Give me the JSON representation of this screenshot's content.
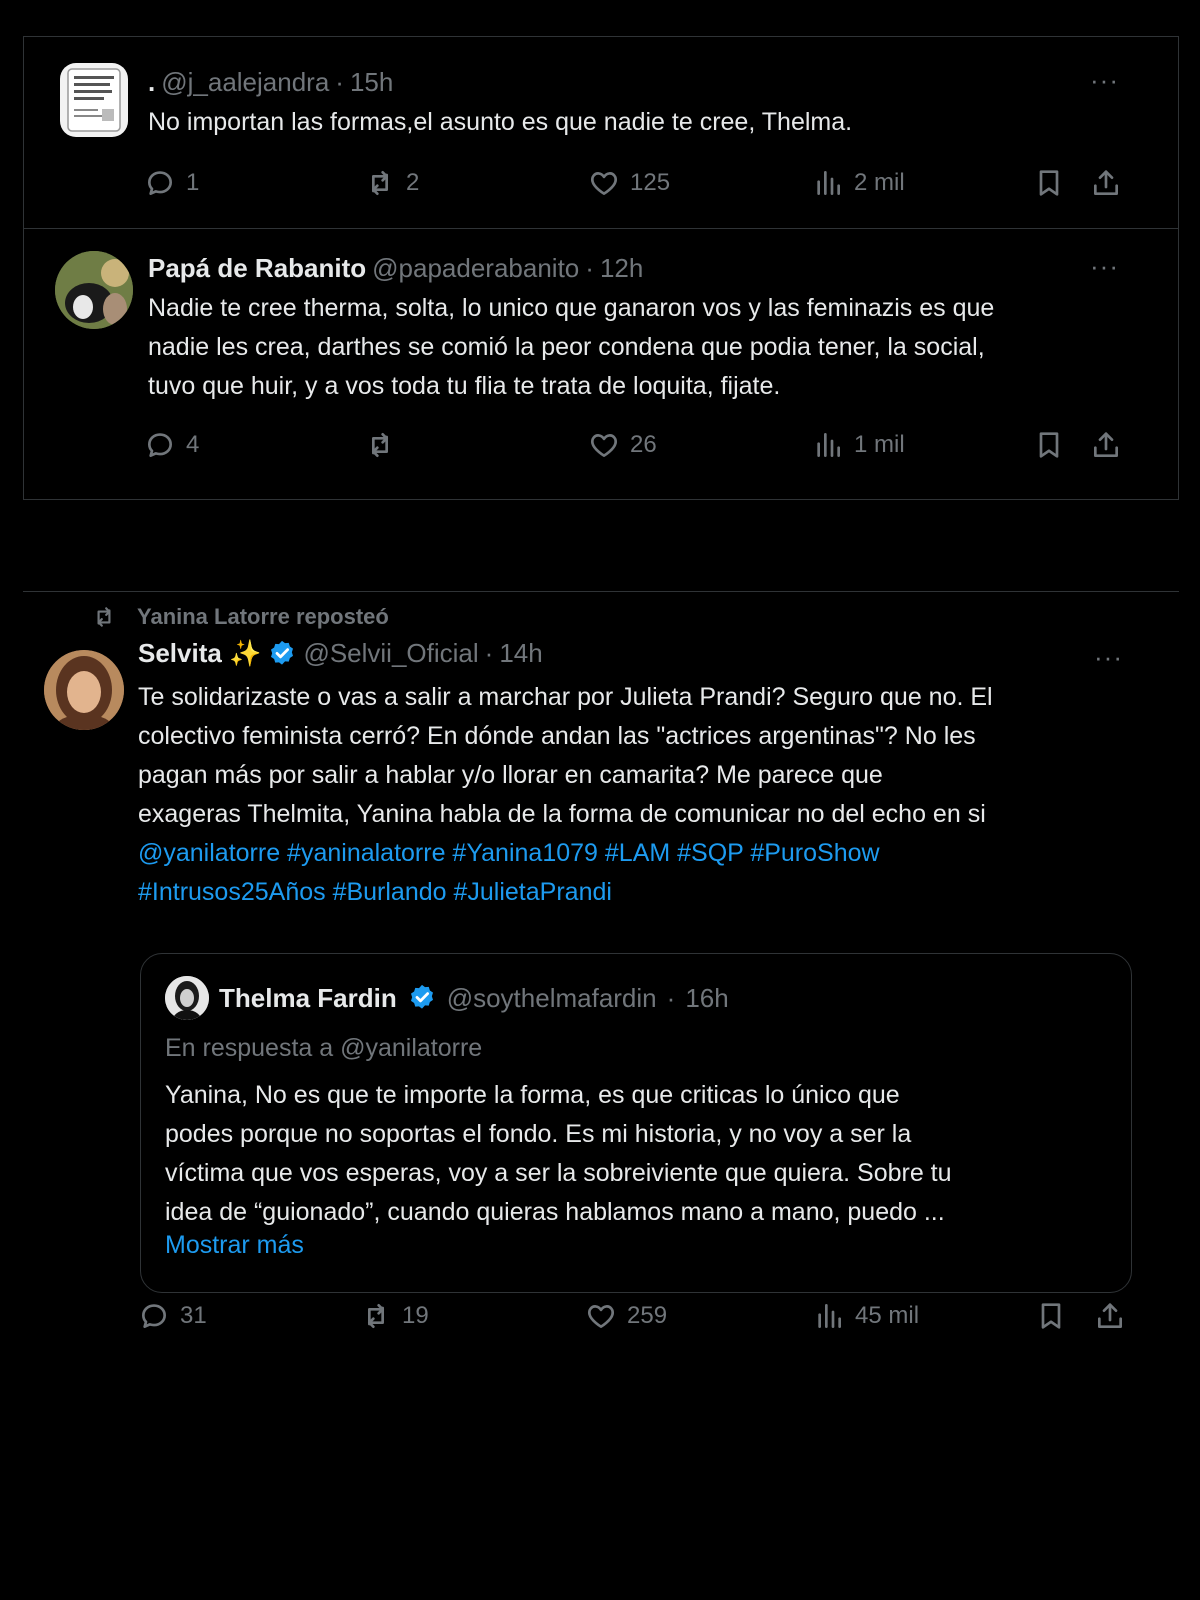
{
  "tweets": [
    {
      "display_name": ".",
      "handle": "@j_aalejandra",
      "time": "15h",
      "text": "No importan las formas,el asunto es que nadie te cree, Thelma.",
      "replies": "1",
      "reposts": "2",
      "likes": "125",
      "views": "2 mil",
      "more": "···"
    },
    {
      "display_name": "Papá de Rabanito",
      "handle": "@papaderabanito",
      "time": "12h",
      "text_lines": [
        "Nadie te cree therma, solta, lo unico que ganaron vos y las feminazis es que",
        "nadie les crea, darthes se comió la peor condena que podia tener, la social,",
        "tuvo que huir, y a vos toda tu flia te trata de loquita, fijate."
      ],
      "replies": "4",
      "reposts": "",
      "likes": "26",
      "views": "1 mil",
      "more": "···"
    },
    {
      "repost_note": "Yanina Latorre reposteó",
      "display_name": "Selvita ✨",
      "handle": "@Selvii_Oficial",
      "time": "14h",
      "text_lines": [
        "Te solidarizaste o vas a salir a marchar por Julieta Prandi? Seguro que no. El",
        "colectivo feminista cerró? En dónde andan las \"actrices argentinas\"? No les",
        "pagan más por salir a hablar y/o llorar en camarita? Me parece que",
        "exageras Thelmita, Yanina habla de la forma de comunicar no del echo en si"
      ],
      "links_line_1": "@yanilatorre #yaninalatorre #Yanina1079 #LAM #SQP #PuroShow",
      "links_line_2": "#Intrusos25Años #Burlando #JulietaPrandi",
      "replies": "31",
      "reposts": "19",
      "likes": "259",
      "views": "45 mil",
      "more": "···",
      "quote": {
        "display_name": "Thelma Fardin",
        "handle": "@soythelmafardin",
        "time": "16h",
        "reply_to": "En respuesta a @yanilatorre",
        "text_lines": [
          "Yanina, No es que te importe la forma, es que criticas lo único que",
          "podes porque no soportas el fondo. Es mi historia, y no voy a ser la",
          "víctima que vos esperas, voy a ser la sobreiviente que quiera. Sobre tu",
          "idea de “guionado”, cuando quieras hablamos mano a mano, puedo ..."
        ],
        "show_more": "Mostrar más"
      }
    }
  ],
  "separator": "·",
  "colors": {
    "background": "#000000",
    "text": "#e7e9ea",
    "muted": "#71767b",
    "link": "#1d9bf0",
    "border": "#2f3336",
    "verified": "#1d9bf0"
  },
  "icons": [
    "reply-icon",
    "repost-icon",
    "like-icon",
    "views-icon",
    "bookmark-icon",
    "share-icon",
    "verified-badge-icon",
    "more-icon"
  ]
}
